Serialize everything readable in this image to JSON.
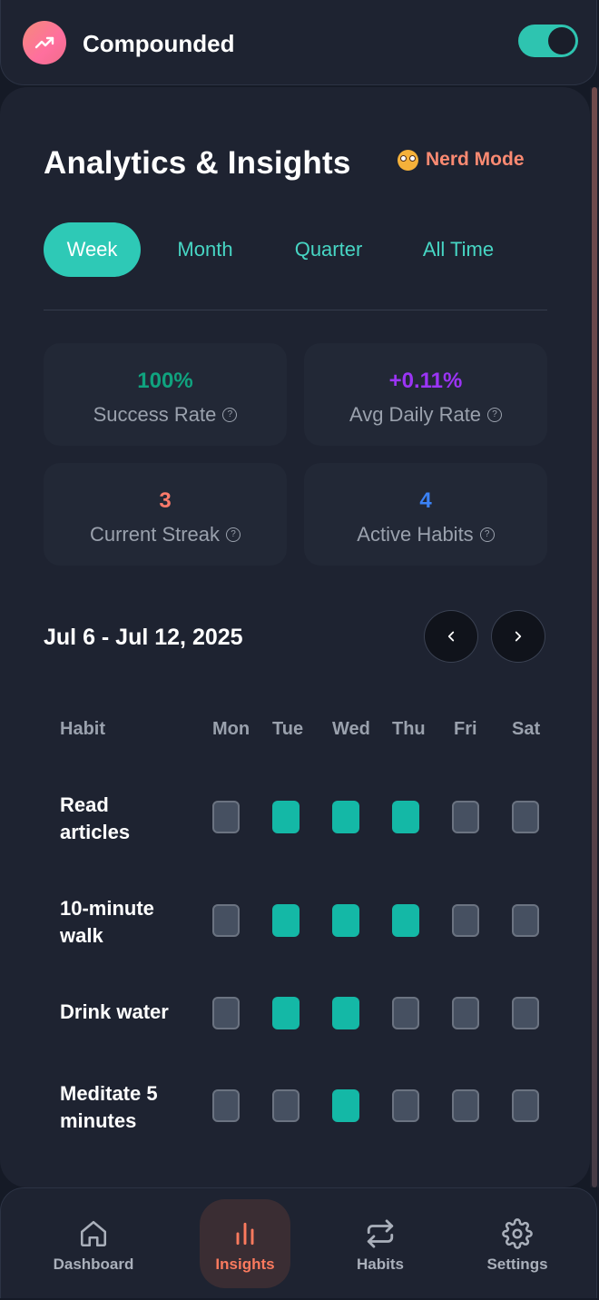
{
  "app": {
    "title": "Compounded"
  },
  "page": {
    "title": "Analytics & Insights",
    "nerd_mode_label": "Nerd Mode"
  },
  "tabs": [
    {
      "label": "Week",
      "active": true
    },
    {
      "label": "Month",
      "active": false
    },
    {
      "label": "Quarter",
      "active": false
    },
    {
      "label": "All Time",
      "active": false
    }
  ],
  "stats": [
    {
      "value": "100%",
      "label": "Success Rate",
      "color": "#10a37f"
    },
    {
      "value": "+0.11%",
      "label": "Avg Daily Rate",
      "color": "#9b34f5"
    },
    {
      "value": "3",
      "label": "Current Streak",
      "color": "#fb7a6b"
    },
    {
      "value": "4",
      "label": "Active Habits",
      "color": "#3b82f6"
    }
  ],
  "calendar": {
    "range": "Jul 6 - Jul 12, 2025",
    "headers": [
      "Habit",
      "Mon",
      "Tue",
      "Wed",
      "Thu",
      "Fri",
      "Sat"
    ],
    "rows": [
      {
        "name": "Read articles",
        "days": [
          false,
          true,
          true,
          true,
          false,
          false
        ]
      },
      {
        "name": "10-minute walk",
        "days": [
          false,
          true,
          true,
          true,
          false,
          false
        ]
      },
      {
        "name": "Drink water",
        "days": [
          false,
          true,
          true,
          false,
          false,
          false
        ]
      },
      {
        "name": "Meditate 5 minutes",
        "days": [
          false,
          false,
          true,
          false,
          false,
          false
        ]
      }
    ]
  },
  "nav": [
    {
      "label": "Dashboard",
      "icon": "home-icon",
      "active": false
    },
    {
      "label": "Insights",
      "icon": "bar-chart-icon",
      "active": true
    },
    {
      "label": "Habits",
      "icon": "repeat-icon",
      "active": false
    },
    {
      "label": "Settings",
      "icon": "gear-icon",
      "active": false
    }
  ],
  "colors": {
    "accent": "#2ec9b6",
    "active_nav": "#fb7a5e",
    "check_on": "#14b8a6"
  }
}
